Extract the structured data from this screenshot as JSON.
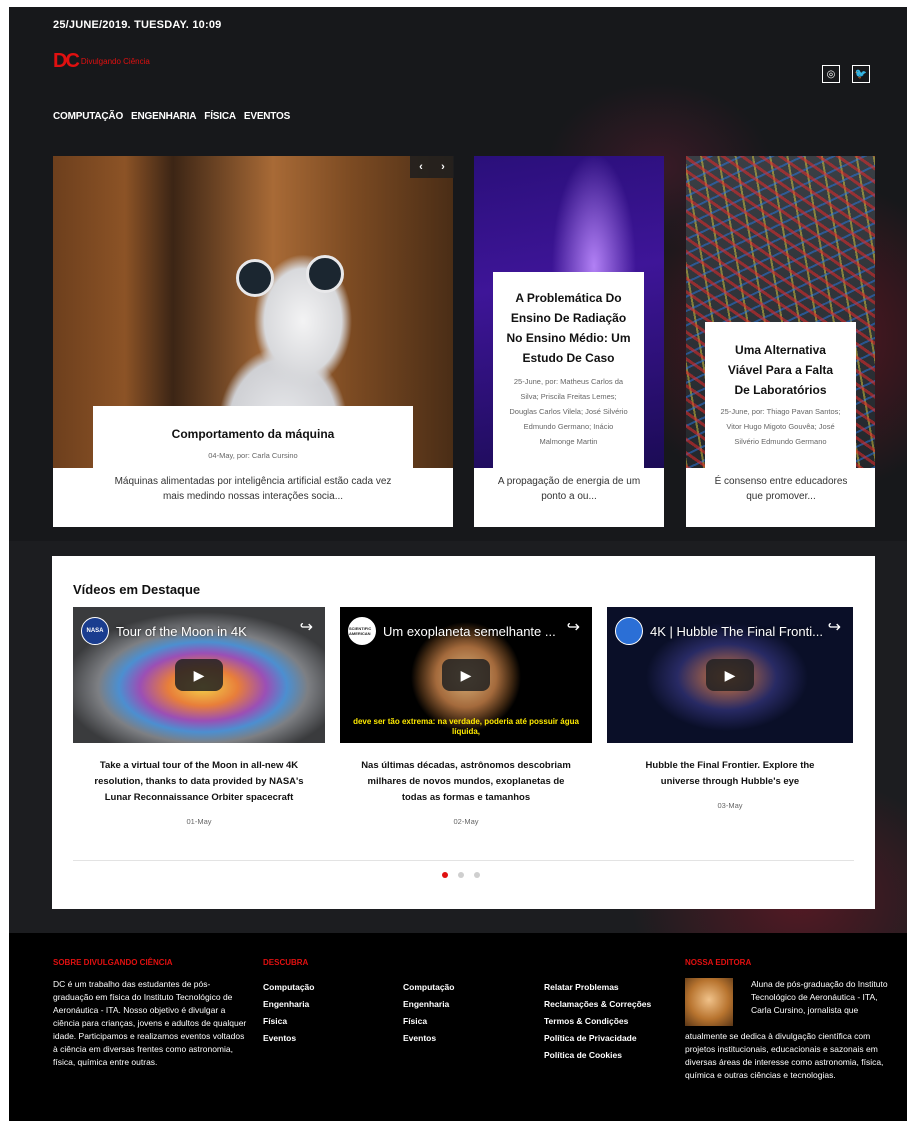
{
  "header": {
    "date": "25/JUNE/2019. TUESDAY. 10:09",
    "logo_mark": "DC",
    "logo_text": "Divulgando Ciência",
    "social": [
      "◎",
      "🐦"
    ],
    "nav": [
      "COMPUTAÇÃO",
      "ENGENHARIA",
      "FÍSICA",
      "EVENTOS"
    ]
  },
  "featured": {
    "arrows": [
      "‹",
      "›"
    ],
    "main": {
      "title": "Comportamento da máquina",
      "meta": "04-May, por: Carla Cursino",
      "excerpt": "Máquinas alimentadas por inteligência artificial estão cada vez mais medindo nossas interações socia..."
    },
    "second": {
      "title": "A Problemática Do Ensino De Radiação No Ensino Médio: Um Estudo De Caso",
      "meta": "25-June, por: Matheus Carlos da Silva; Priscila Freitas Lemes; Douglas Carlos Vilela; José Silvério Edmundo Germano; Inácio Malmonge Martin",
      "excerpt": "A propagação de energia de um ponto a ou..."
    },
    "third": {
      "title": "Uma Alternativa Viável Para a Falta De Laboratórios",
      "meta": "25-June, por: Thiago Pavan Santos; Vitor Hugo Migoto Gouvêa; José Silvério Edmundo Germano",
      "excerpt": "É consenso entre educadores que promover..."
    }
  },
  "videos": {
    "heading": "Vídeos em Destaque",
    "items": [
      {
        "avatar": "NASA",
        "title": "Tour of the Moon in 4K",
        "caption": "",
        "desc": "Take a virtual tour of the Moon in all-new 4K resolution, thanks to data provided by NASA's Lunar Reconnaissance Orbiter spacecraft",
        "date": "01-May"
      },
      {
        "avatar": "SCIENTIFIC AMERICAN",
        "title": "Um exoplaneta semelhante ...",
        "caption": "deve ser tão extrema: na verdade, poderia até possuir água líquida,",
        "desc": "Nas últimas décadas, astrônomos descobriam milhares de novos mundos, exoplanetas de todas as formas e tamanhos",
        "date": "02-May"
      },
      {
        "avatar": "",
        "title": "4K | Hubble The Final Fronti...",
        "caption": "",
        "desc": "Hubble the Final Frontier. Explore the universe through Hubble's eye",
        "date": "03-May"
      }
    ]
  },
  "footer": {
    "about_heading": "SOBRE DIVULGANDO CIÊNCIA",
    "about_text": "DC é um trabalho das estudantes de pós-graduação em física do Instituto Tecnológico de Aeronáutica - ITA. Nosso objetivo é divulgar a ciência para crianças, jovens e adultos de qualquer idade. Participamos e realizamos eventos voltados à ciência em diversas frentes como astronomia, física, química entre outras.",
    "discover_heading": "DESCUBRA",
    "discover_col1": [
      "Computação",
      "Engenharia",
      "Física",
      "Eventos"
    ],
    "discover_col2": [
      "Computação",
      "Engenharia",
      "Física",
      "Eventos"
    ],
    "discover_col3": [
      "Relatar Problemas",
      "Reclamações & Correções",
      "Termos & Condições",
      "Política de Privacidade",
      "Política de Cookies"
    ],
    "editor_heading": "NOSSA EDITORA",
    "editor_text_right": "Aluna de pós-graduação do Instituto Tecnológico de Aeronáutica - ITA, Carla Cursino, jornalista que",
    "editor_text_full": "atualmente se dedica à divulgação científica com projetos institucionais, educacionais e sazonais em diversas áreas de interesse como astronomia, física, química e outras ciências e tecnologias."
  }
}
